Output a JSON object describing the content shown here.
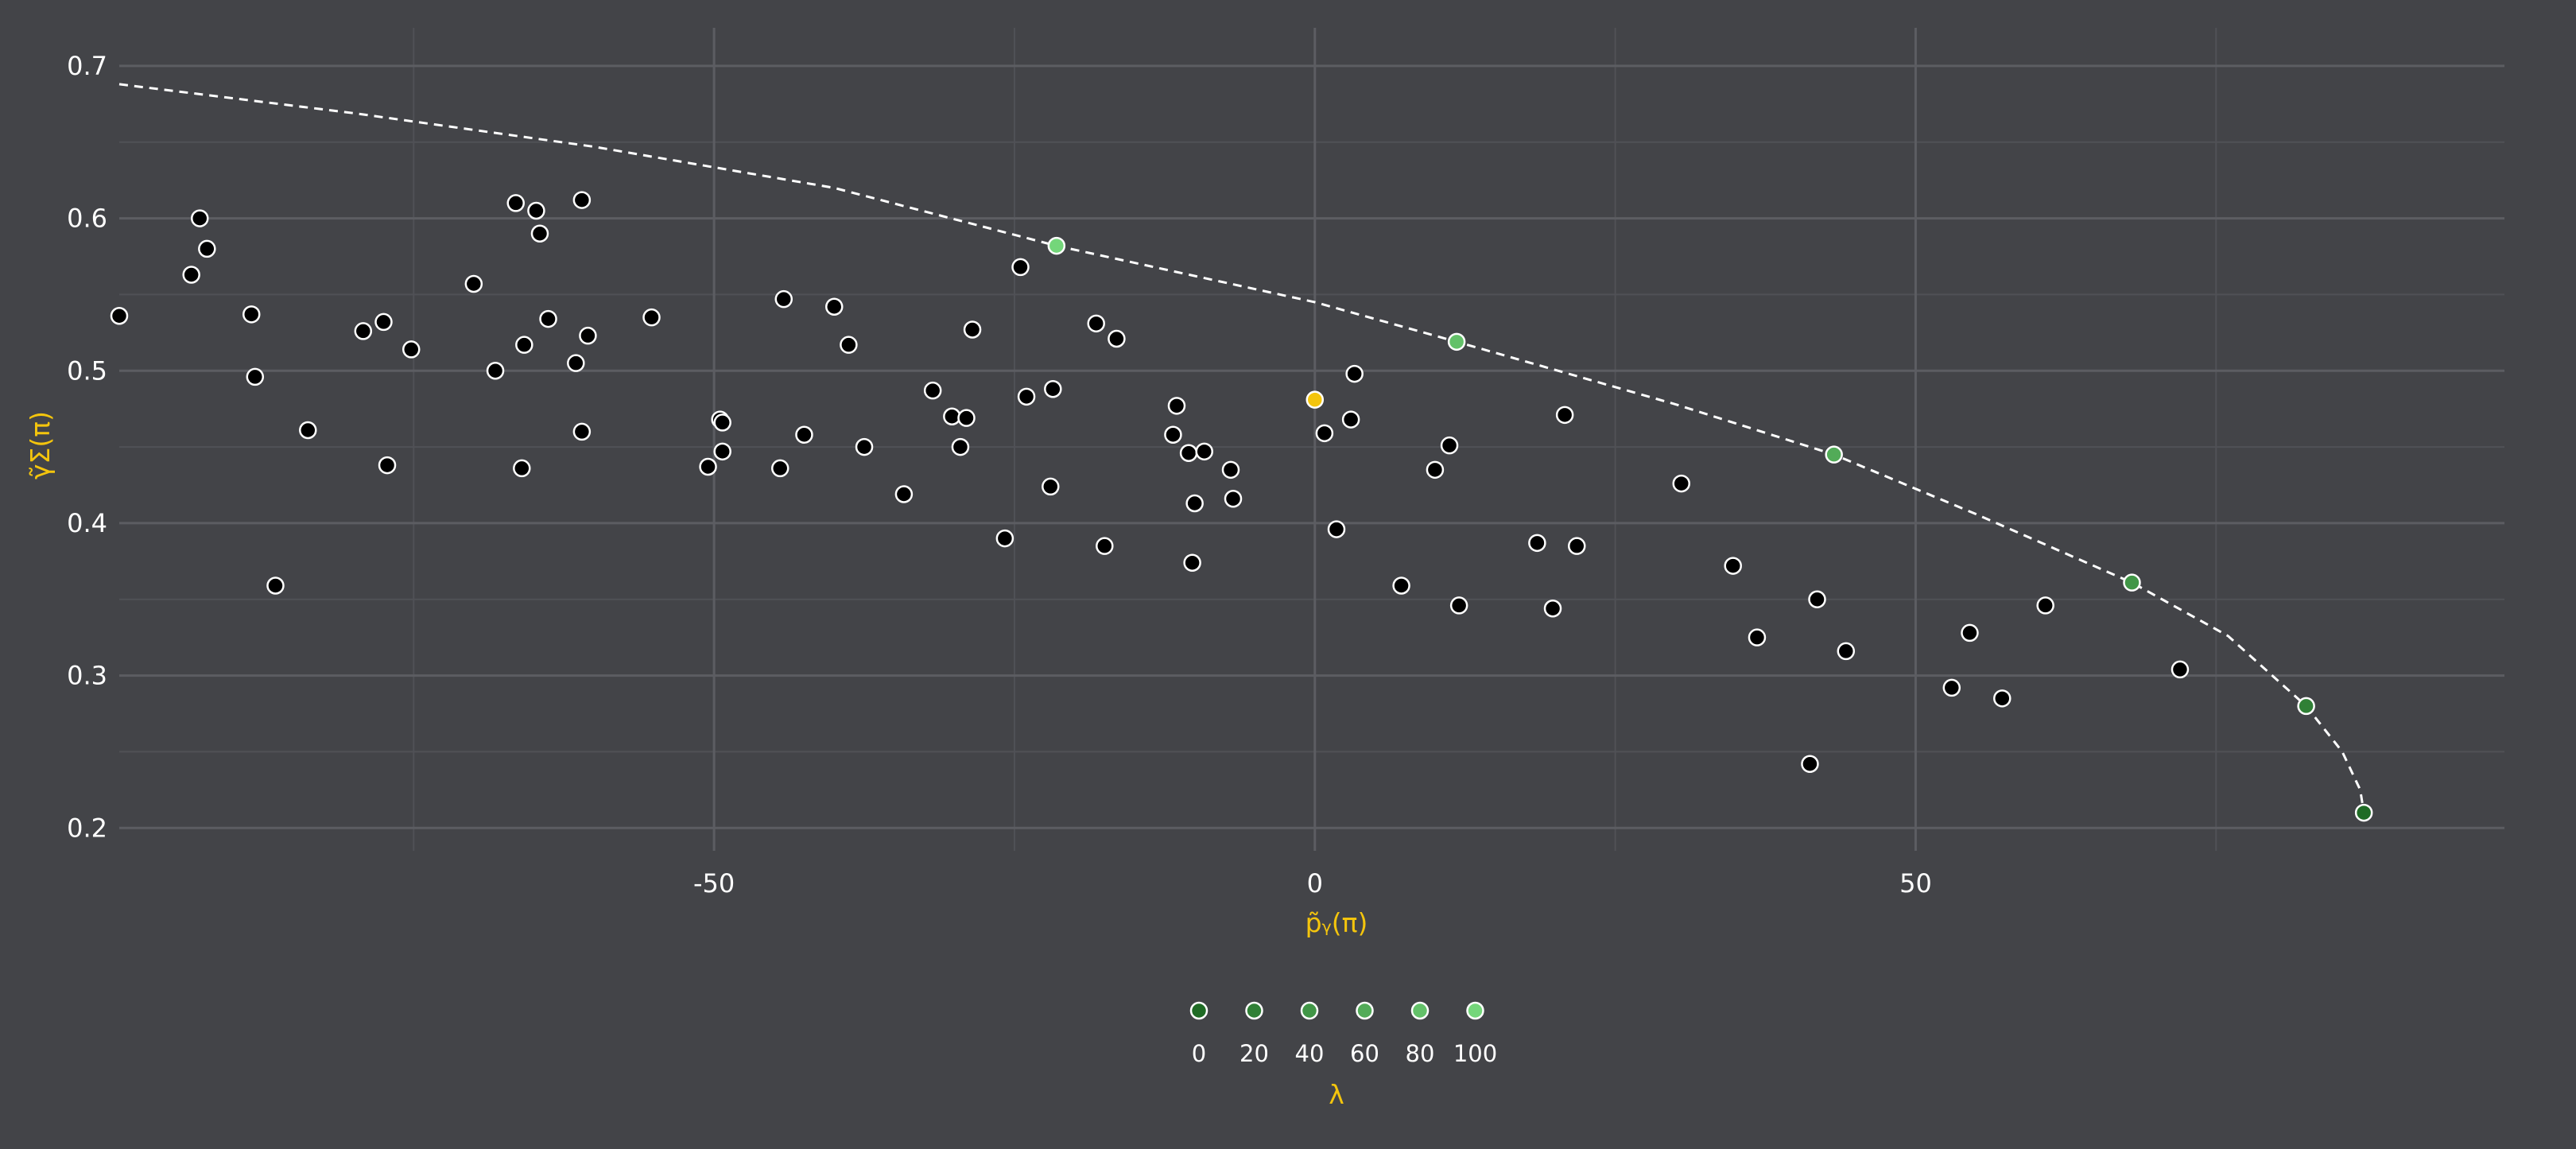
{
  "chart_data": {
    "type": "scatter",
    "title": "",
    "xlabel": "p̃ᵧ(π)",
    "ylabel": "γ̃Σ(π)",
    "xlim": [
      -99.5,
      99
    ],
    "ylim": [
      0.185,
      0.725
    ],
    "x_ticks": [
      -50,
      0,
      50
    ],
    "x_tick_labels": [
      "-50",
      "0",
      "50"
    ],
    "y_ticks": [
      0.2,
      0.3,
      0.4,
      0.5,
      0.6,
      0.7
    ],
    "y_tick_labels": [
      "0.2",
      "0.3",
      "0.4",
      "0.5",
      "0.6",
      "0.7"
    ],
    "grid": true,
    "colors": {
      "background": "#434448",
      "grid_major": "#5c5d62",
      "grid_minor": "#505156",
      "axis_text": "#ffffff",
      "axis_title": "#f4c50d",
      "point_fill": "#000000",
      "point_stroke": "#ffffff",
      "highlight_point": "#f4c50d",
      "frontier_line": "#ffffff",
      "lambda_low": "#1f6b25",
      "lambda_high": "#74d67a"
    },
    "series": [
      {
        "role": "candidates",
        "points": [
          [
            -99.5,
            0.536
          ],
          [
            -93.5,
            0.563
          ],
          [
            -92.8,
            0.6
          ],
          [
            -92.2,
            0.58
          ],
          [
            -88.5,
            0.537
          ],
          [
            -88.2,
            0.496
          ],
          [
            -86.5,
            0.359
          ],
          [
            -83.8,
            0.461
          ],
          [
            -79.2,
            0.526
          ],
          [
            -77.5,
            0.532
          ],
          [
            -77.2,
            0.438
          ],
          [
            -75.2,
            0.514
          ],
          [
            -70.0,
            0.557
          ],
          [
            -68.2,
            0.5
          ],
          [
            -66.5,
            0.61
          ],
          [
            -66.0,
            0.436
          ],
          [
            -65.8,
            0.517
          ],
          [
            -64.8,
            0.605
          ],
          [
            -64.5,
            0.59
          ],
          [
            -63.8,
            0.534
          ],
          [
            -61.5,
            0.505
          ],
          [
            -61.0,
            0.612
          ],
          [
            -61.0,
            0.46
          ],
          [
            -60.5,
            0.523
          ],
          [
            -55.2,
            0.535
          ],
          [
            -50.5,
            0.437
          ],
          [
            -49.5,
            0.468
          ],
          [
            -49.3,
            0.466
          ],
          [
            -49.3,
            0.447
          ],
          [
            -44.5,
            0.436
          ],
          [
            -44.2,
            0.547
          ],
          [
            -42.5,
            0.458
          ],
          [
            -40.0,
            0.542
          ],
          [
            -38.8,
            0.517
          ],
          [
            -37.5,
            0.45
          ],
          [
            -34.2,
            0.419
          ],
          [
            -31.8,
            0.487
          ],
          [
            -30.2,
            0.47
          ],
          [
            -29.5,
            0.45
          ],
          [
            -29.0,
            0.469
          ],
          [
            -28.5,
            0.527
          ],
          [
            -25.8,
            0.39
          ],
          [
            -24.5,
            0.568
          ],
          [
            -24.0,
            0.483
          ],
          [
            -22.0,
            0.424
          ],
          [
            -21.8,
            0.488
          ],
          [
            -18.2,
            0.531
          ],
          [
            -17.5,
            0.385
          ],
          [
            -16.5,
            0.521
          ],
          [
            -11.8,
            0.458
          ],
          [
            -11.5,
            0.477
          ],
          [
            -10.5,
            0.446
          ],
          [
            -10.2,
            0.374
          ],
          [
            -10.0,
            0.413
          ],
          [
            -9.2,
            0.447
          ],
          [
            -7.0,
            0.435
          ],
          [
            -6.8,
            0.416
          ],
          [
            0.8,
            0.459
          ],
          [
            1.8,
            0.396
          ],
          [
            3.0,
            0.468
          ],
          [
            3.3,
            0.498
          ],
          [
            7.2,
            0.359
          ],
          [
            10.0,
            0.435
          ],
          [
            11.2,
            0.451
          ],
          [
            12.0,
            0.346
          ],
          [
            18.5,
            0.387
          ],
          [
            19.8,
            0.344
          ],
          [
            20.8,
            0.471
          ],
          [
            21.8,
            0.385
          ],
          [
            30.5,
            0.426
          ],
          [
            34.8,
            0.372
          ],
          [
            36.8,
            0.325
          ],
          [
            41.2,
            0.242
          ],
          [
            41.8,
            0.35
          ],
          [
            44.2,
            0.316
          ],
          [
            53.0,
            0.292
          ],
          [
            54.5,
            0.328
          ],
          [
            57.2,
            0.285
          ],
          [
            60.8,
            0.346
          ],
          [
            72.0,
            0.304
          ]
        ]
      },
      {
        "role": "reference",
        "points": [
          [
            0.0,
            0.481
          ]
        ]
      },
      {
        "role": "frontier",
        "points": [
          [
            87.3,
            0.21,
            0
          ],
          [
            82.5,
            0.28,
            20
          ],
          [
            68.0,
            0.361,
            40
          ],
          [
            43.2,
            0.445,
            60
          ],
          [
            11.8,
            0.519,
            80
          ],
          [
            -21.5,
            0.582,
            100
          ]
        ]
      },
      {
        "role": "frontier-curve",
        "points": [
          [
            -99.5,
            0.688
          ],
          [
            -80,
            0.669
          ],
          [
            -60,
            0.647
          ],
          [
            -40,
            0.62
          ],
          [
            -21.5,
            0.582
          ],
          [
            0,
            0.545
          ],
          [
            11.8,
            0.519
          ],
          [
            30,
            0.478
          ],
          [
            43.2,
            0.445
          ],
          [
            55,
            0.406
          ],
          [
            68.0,
            0.361
          ],
          [
            76,
            0.326
          ],
          [
            82.5,
            0.28
          ],
          [
            85.5,
            0.25
          ],
          [
            87.0,
            0.225
          ],
          [
            87.3,
            0.21
          ]
        ]
      }
    ],
    "legend": {
      "title": "λ",
      "placement": "bottom",
      "values": [
        0,
        20,
        40,
        60,
        80,
        100
      ],
      "labels": [
        "0",
        "20",
        "40",
        "60",
        "80",
        "100"
      ]
    }
  }
}
